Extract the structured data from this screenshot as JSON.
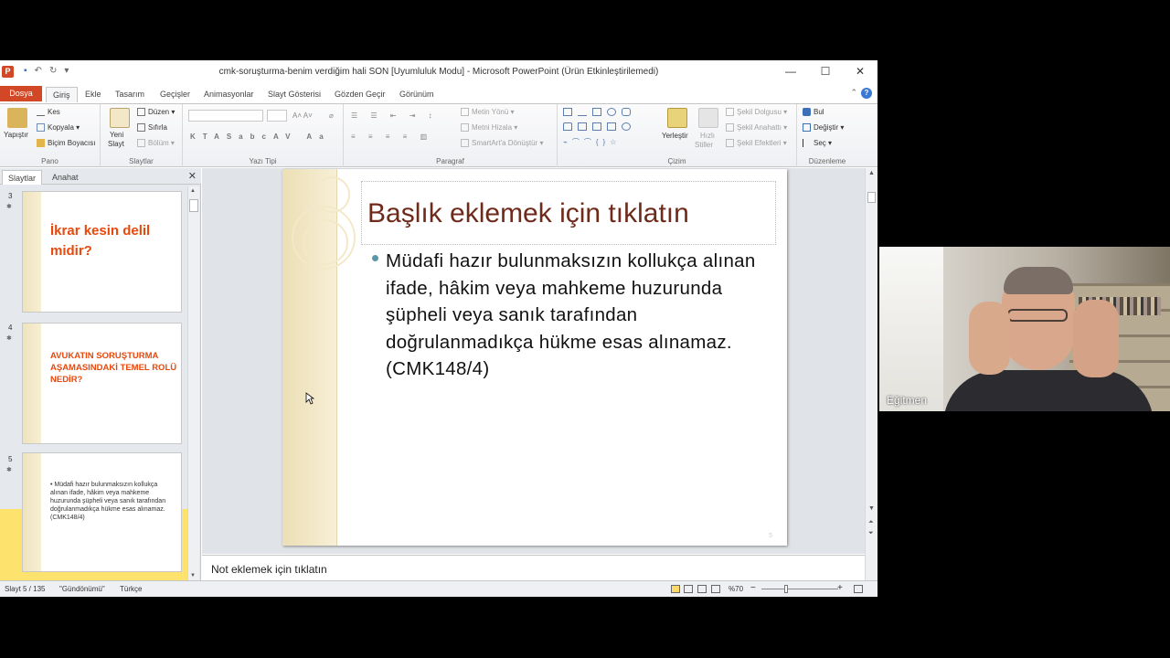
{
  "window": {
    "app_letter": "P",
    "title": "cmk-soruşturma-benim verdiğim hali SON [Uyumluluk Modu]  -  Microsoft PowerPoint (Ürün Etkinleştirilemedi)",
    "min": "—",
    "max": "☐",
    "close": "✕"
  },
  "tabs": {
    "file": "Dosya",
    "items": [
      "Giriş",
      "Ekle",
      "Tasarım",
      "Geçişler",
      "Animasyonlar",
      "Slayt Gösterisi",
      "Gözden Geçir",
      "Görünüm"
    ],
    "help": "?",
    "minimize": "⌃"
  },
  "ribbon": {
    "pano": {
      "label": "Pano",
      "paste": "Yapıştır",
      "cut": "Kes",
      "copy": "Kopyala",
      "format": "Biçim Boyacısı"
    },
    "slaytlar": {
      "label": "Slaytlar",
      "new_slide_1": "Yeni",
      "new_slide_2": "Slayt",
      "layout": "Düzen",
      "reset": "Sıfırla",
      "section": "Bölüm"
    },
    "yazi": {
      "label": "Yazı Tipi"
    },
    "paragraf": {
      "label": "Paragraf",
      "text_dir": "Metin Yönü",
      "align_text": "Metni Hizala",
      "smartart": "SmartArt'a Dönüştür"
    },
    "cizim": {
      "label": "Çizim",
      "arrange": "Yerleştir",
      "quick_1": "Hızlı",
      "quick_2": "Stiller",
      "fill": "Şekil Dolgusu",
      "outline": "Şekil Anahattı",
      "effects": "Şekil Efektleri"
    },
    "duzenleme": {
      "label": "Düzenleme",
      "find": "Bul",
      "replace": "Değiştir",
      "select": "Seç"
    }
  },
  "left_pane": {
    "tab_slides": "Slaytlar",
    "tab_outline": "Anahat",
    "close": "✕",
    "thumbnails": [
      {
        "number": "3",
        "title": "İkrar kesin delil midir?"
      },
      {
        "number": "4",
        "title": "AVUKATIN SORUŞTURMA AŞAMASINDAKİ TEMEL ROLÜ NEDİR?"
      },
      {
        "number": "5",
        "body": "• Müdafi hazır bulunmaksızın kollukça alınan ifade, hâkim veya mahkeme huzurunda şüpheli veya sanık tarafından doğrulanmadıkça hükme esas alınamaz. (CMK148/4)"
      }
    ]
  },
  "slide": {
    "title_placeholder": "Başlık eklemek için tıklatın",
    "body": "Müdafi hazır bulunmaksızın kollukça alınan ifade, hâkim veya mahkeme huzurunda şüpheli veya sanık tarafından doğrulanmadıkça hükme esas alınamaz. (CMK148/4)",
    "page_number": "5"
  },
  "notes": {
    "placeholder": "Not eklemek için tıklatın"
  },
  "status": {
    "slide_info": "Slayt 5 / 135",
    "theme": "\"Gündönümü\"",
    "language": "Türkçe",
    "zoom": "%70",
    "zoom_out": "−",
    "zoom_in": "+"
  },
  "webcam": {
    "label": "Eğitmen"
  },
  "colors": {
    "file_tab": "#d24726",
    "thumb_title": "#e8480c",
    "slide_title": "#6e2a1a",
    "selected_thumb": "#fde26e"
  }
}
